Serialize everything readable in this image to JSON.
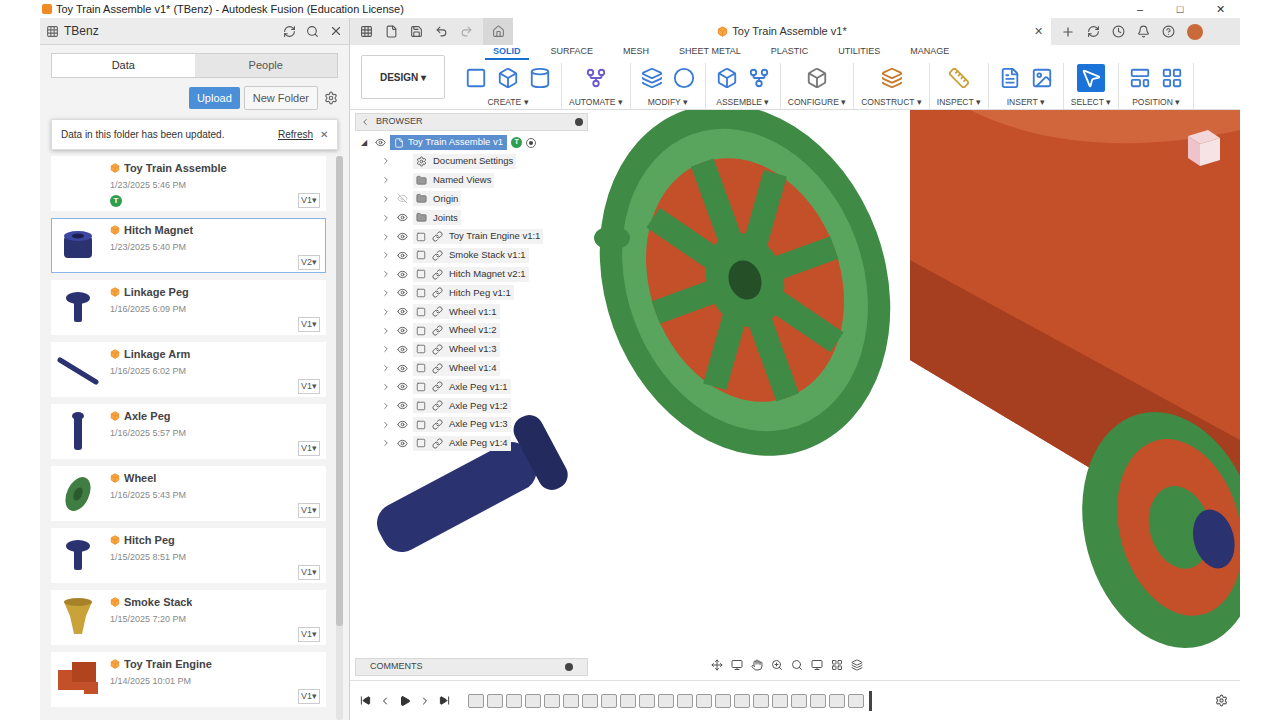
{
  "window": {
    "title": "Toy Train Assemble v1* (TBenz) - Autodesk Fusion (Education License)",
    "controls": [
      "–",
      "□",
      "✕"
    ]
  },
  "caret": "▾",
  "data_panel": {
    "user": "TBenz",
    "tabs": [
      {
        "label": "Data",
        "selected": true
      },
      {
        "label": "People",
        "selected": false
      }
    ],
    "buttons": [
      "Upload",
      "New Folder"
    ],
    "notice": {
      "text": "Data in this folder has been updated.",
      "action": "Refresh",
      "close": "✕"
    },
    "files": [
      {
        "name": "Toy Train Assemble",
        "date": "1/23/2025 5:46 PM",
        "version": "V1",
        "selected": false,
        "kind": "blank",
        "color": "#ffffff",
        "badge": "T"
      },
      {
        "name": "Hitch Magnet",
        "date": "1/23/2025 5:40 PM",
        "version": "V2",
        "selected": true,
        "kind": "magnet",
        "color": "#2b3270",
        "badge": ""
      },
      {
        "name": "Linkage Peg",
        "date": "1/16/2025 6:09 PM",
        "version": "V1",
        "selected": false,
        "kind": "peg",
        "color": "#2b3270",
        "badge": ""
      },
      {
        "name": "Linkage Arm",
        "date": "1/16/2025 6:02 PM",
        "version": "V1",
        "selected": false,
        "kind": "arm",
        "color": "#2b3270",
        "badge": ""
      },
      {
        "name": "Axle Peg",
        "date": "1/16/2025 5:57 PM",
        "version": "V1",
        "selected": false,
        "kind": "axle",
        "color": "#2b3270",
        "badge": ""
      },
      {
        "name": "Wheel",
        "date": "1/16/2025 5:43 PM",
        "version": "V1",
        "selected": false,
        "kind": "wheel",
        "color": "#3f7d43",
        "badge": ""
      },
      {
        "name": "Hitch Peg",
        "date": "1/15/2025 8:51 PM",
        "version": "V1",
        "selected": false,
        "kind": "peg",
        "color": "#2b3270",
        "badge": ""
      },
      {
        "name": "Smoke Stack",
        "date": "1/15/2025 7:20 PM",
        "version": "V1",
        "selected": false,
        "kind": "stack",
        "color": "#c9a23a",
        "badge": ""
      },
      {
        "name": "Toy Train Engine",
        "date": "1/14/2025 10:01 PM",
        "version": "V1",
        "selected": false,
        "kind": "engine",
        "color": "#c4502a",
        "badge": ""
      }
    ]
  },
  "document": {
    "tab": "Toy Train Assemble v1*",
    "close": "✕"
  },
  "toolbar": {
    "workspace": "DESIGN",
    "tabs": [
      {
        "label": "SOLID",
        "selected": true
      },
      {
        "label": "SURFACE",
        "selected": false
      },
      {
        "label": "MESH",
        "selected": false
      },
      {
        "label": "SHEET METAL",
        "selected": false
      },
      {
        "label": "PLASTIC",
        "selected": false
      },
      {
        "label": "UTILITIES",
        "selected": false
      },
      {
        "label": "MANAGE",
        "selected": false
      }
    ],
    "groups": [
      {
        "label": "CREATE",
        "icons": 3,
        "selected": false
      },
      {
        "label": "AUTOMATE",
        "icons": 1,
        "selected": false
      },
      {
        "label": "MODIFY",
        "icons": 2,
        "selected": false
      },
      {
        "label": "ASSEMBLE",
        "icons": 2,
        "selected": false
      },
      {
        "label": "CONFIGURE",
        "icons": 1,
        "selected": false
      },
      {
        "label": "CONSTRUCT",
        "icons": 1,
        "selected": false
      },
      {
        "label": "INSPECT",
        "icons": 1,
        "selected": false
      },
      {
        "label": "INSERT",
        "icons": 2,
        "selected": false
      },
      {
        "label": "SELECT",
        "icons": 1,
        "selected": true
      },
      {
        "label": "POSITION",
        "icons": 2,
        "selected": false
      }
    ]
  },
  "browser": {
    "title": "BROWSER",
    "root": {
      "name": "Toy Train Assemble v1",
      "badge": "T",
      "selected": true
    },
    "items": [
      {
        "name": "Document Settings",
        "kind": "settings",
        "visible": true
      },
      {
        "name": "Named Views",
        "kind": "views",
        "visible": true
      },
      {
        "name": "Origin",
        "kind": "folder",
        "visible": false
      },
      {
        "name": "Joints",
        "kind": "folder",
        "visible": true
      },
      {
        "name": "Toy Train Engine v1:1",
        "kind": "component",
        "visible": true
      },
      {
        "name": "Smoke Stack v1:1",
        "kind": "component",
        "visible": true
      },
      {
        "name": "Hitch Magnet v2:1",
        "kind": "component",
        "visible": true
      },
      {
        "name": "Hitch Peg v1:1",
        "kind": "component",
        "visible": true
      },
      {
        "name": "Wheel v1:1",
        "kind": "component",
        "visible": true
      },
      {
        "name": "Wheel v1:2",
        "kind": "component",
        "visible": true
      },
      {
        "name": "Wheel v1:3",
        "kind": "component",
        "visible": true
      },
      {
        "name": "Wheel v1:4",
        "kind": "component",
        "visible": true
      },
      {
        "name": "Axle Peg v1:1",
        "kind": "component",
        "visible": true
      },
      {
        "name": "Axle Peg v1:2",
        "kind": "component",
        "visible": true
      },
      {
        "name": "Axle Peg v1:3",
        "kind": "component",
        "visible": true
      },
      {
        "name": "Axle Peg v1:4",
        "kind": "component",
        "visible": true
      }
    ]
  },
  "comments": {
    "title": "COMMENTS"
  },
  "timeline": {
    "steps": 21
  }
}
